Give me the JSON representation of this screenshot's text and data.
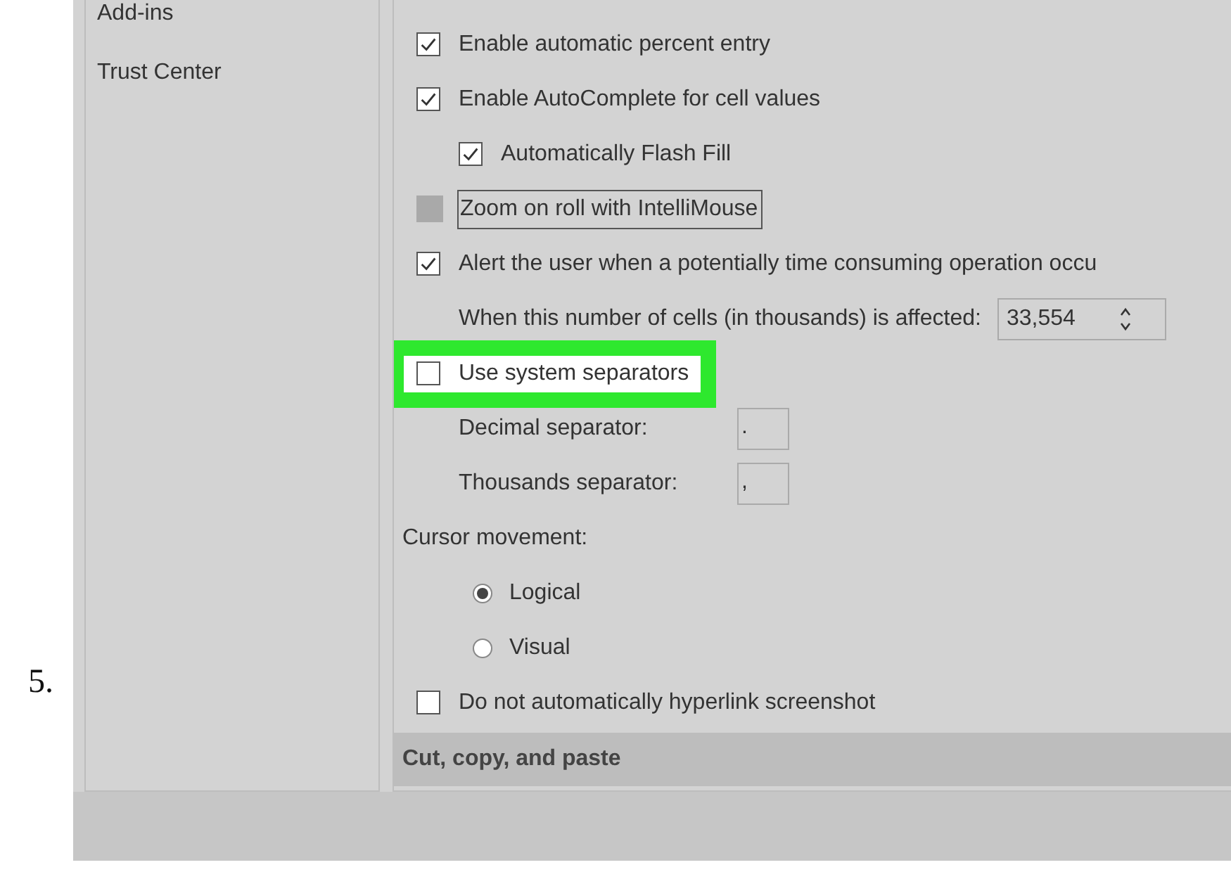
{
  "step_number": "5.",
  "sidebar": {
    "items": [
      {
        "label": "Add-ins",
        "selected": false
      },
      {
        "label": "Trust Center",
        "selected": false
      }
    ]
  },
  "options": [
    {
      "kind": "checkbox",
      "label": "Enable automatic percent entry",
      "checked": true
    },
    {
      "kind": "checkbox",
      "label": "Enable AutoComplete for cell values",
      "checked": true,
      "children": [
        {
          "kind": "checkbox",
          "label": "Automatically Flash Fill",
          "checked": true
        }
      ]
    },
    {
      "kind": "checkbox",
      "label": "Zoom on roll with IntelliMouse",
      "checked": false,
      "disabled": true,
      "focused": true
    },
    {
      "kind": "checkbox",
      "label": "Alert the user when a potentially time consuming operation occu",
      "checked": true,
      "children": [
        {
          "kind": "spinner",
          "label": "When this number of cells (in thousands) is affected:",
          "value": "33,554"
        }
      ]
    },
    {
      "kind": "checkbox",
      "label": "Use system separators",
      "checked": false,
      "highlighted": true,
      "children": [
        {
          "kind": "field",
          "label": "Decimal separator:",
          "value": "."
        },
        {
          "kind": "field",
          "label": "Thousands separator:",
          "value": ","
        }
      ]
    },
    {
      "kind": "label",
      "label": "Cursor movement:",
      "children": [
        {
          "kind": "radio",
          "label": "Logical",
          "selected": true
        },
        {
          "kind": "radio",
          "label": "Visual",
          "selected": false
        }
      ]
    },
    {
      "kind": "checkbox",
      "label": "Do not automatically hyperlink screenshot",
      "checked": false
    }
  ],
  "section_header": "Cut, copy, and paste"
}
